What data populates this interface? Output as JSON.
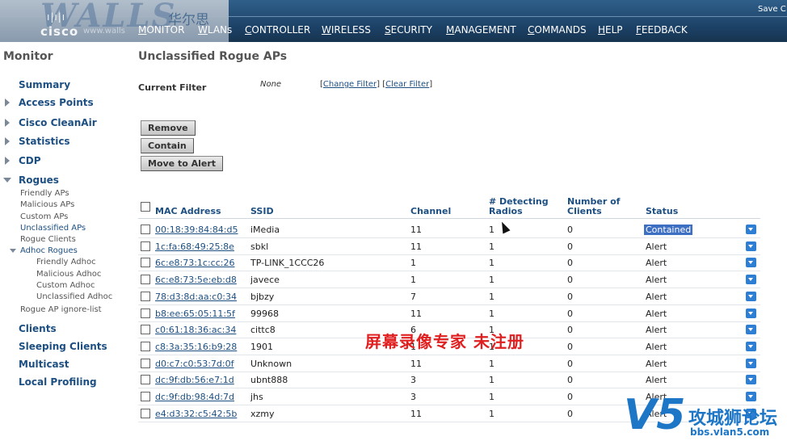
{
  "header": {
    "logo_text": "WALLS",
    "logo_cn": "华尔思",
    "logo_brand": "cisco",
    "logo_url": "www.walls",
    "save_link": "Save C",
    "nav": [
      "MONITOR",
      "WLANs",
      "CONTROLLER",
      "WIRELESS",
      "SECURITY",
      "MANAGEMENT",
      "COMMANDS",
      "HELP",
      "FEEDBACK"
    ]
  },
  "sidebar": {
    "title": "Monitor",
    "summary": "Summary",
    "access_points": "Access Points",
    "cleanair": "Cisco CleanAir",
    "statistics": "Statistics",
    "cdp": "CDP",
    "rogues": "Rogues",
    "rogue_subs": [
      "Friendly APs",
      "Malicious APs",
      "Custom APs",
      "Unclassified APs",
      "Rogue Clients"
    ],
    "adhoc": "Adhoc Rogues",
    "adhoc_subs": [
      "Friendly Adhoc",
      "Malicious Adhoc",
      "Custom Adhoc",
      "Unclassified Adhoc"
    ],
    "ignore_list": "Rogue AP ignore-list",
    "clients": "Clients",
    "sleeping_clients": "Sleeping Clients",
    "multicast": "Multicast",
    "local_profiling": "Local Profiling"
  },
  "main": {
    "title": "Unclassified Rogue APs",
    "filter_label": "Current Filter",
    "filter_value": "None",
    "change_filter": "Change Filter",
    "clear_filter": "Clear Filter",
    "buttons": {
      "remove": "Remove",
      "contain": "Contain",
      "move_to_alert": "Move to Alert"
    },
    "columns": {
      "mac": "MAC Address",
      "ssid": "SSID",
      "channel": "Channel",
      "detecting_1": "# Detecting",
      "detecting_2": "Radios",
      "clients_1": "Number of",
      "clients_2": "Clients",
      "status": "Status"
    },
    "rows": [
      {
        "mac": "00:18:39:84:84:d5",
        "ssid": "iMedia",
        "channel": "11",
        "radios": "1",
        "clients": "0",
        "status": "Contained"
      },
      {
        "mac": "1c:fa:68:49:25:8e",
        "ssid": "sbkl",
        "channel": "11",
        "radios": "1",
        "clients": "0",
        "status": "Alert"
      },
      {
        "mac": "6c:e8:73:1c:cc:26",
        "ssid": "TP-LINK_1CCC26",
        "channel": "1",
        "radios": "1",
        "clients": "0",
        "status": "Alert"
      },
      {
        "mac": "6c:e8:73:5e:eb:d8",
        "ssid": "javece",
        "channel": "1",
        "radios": "1",
        "clients": "0",
        "status": "Alert"
      },
      {
        "mac": "78:d3:8d:aa:c0:34",
        "ssid": "bjbzy",
        "channel": "7",
        "radios": "1",
        "clients": "0",
        "status": "Alert"
      },
      {
        "mac": "b8:ee:65:05:11:5f",
        "ssid": "99968",
        "channel": "11",
        "radios": "1",
        "clients": "0",
        "status": "Alert"
      },
      {
        "mac": "c0:61:18:36:ac:34",
        "ssid": "cittc8",
        "channel": "6",
        "radios": "1",
        "clients": "0",
        "status": "Alert"
      },
      {
        "mac": "c8:3a:35:16:b9:28",
        "ssid": "1901",
        "channel": "1",
        "radios": "1",
        "clients": "0",
        "status": "Alert"
      },
      {
        "mac": "d0:c7:c0:53:7d:0f",
        "ssid": "Unknown",
        "channel": "11",
        "radios": "1",
        "clients": "0",
        "status": "Alert"
      },
      {
        "mac": "dc:9f:db:56:e7:1d",
        "ssid": "ubnt888",
        "channel": "3",
        "radios": "1",
        "clients": "0",
        "status": "Alert"
      },
      {
        "mac": "dc:9f:db:98:4d:7d",
        "ssid": "jhs",
        "channel": "3",
        "radios": "1",
        "clients": "0",
        "status": "Alert"
      },
      {
        "mac": "e4:d3:32:c5:42:5b",
        "ssid": "xzmy",
        "channel": "11",
        "radios": "1",
        "clients": "0",
        "status": "Alert"
      }
    ]
  },
  "overlay": {
    "watermark": "屏幕录像专家 未注册",
    "site_mark": "V5",
    "site_title": "攻城狮论坛",
    "site_url": "bbs.vlan5.com"
  },
  "colors": {
    "nav_bg": "#1b3f63",
    "link": "#1d4f82",
    "selected": "#3d6fc2",
    "watermark": "#e02020",
    "site_logo": "#1d76c6"
  }
}
